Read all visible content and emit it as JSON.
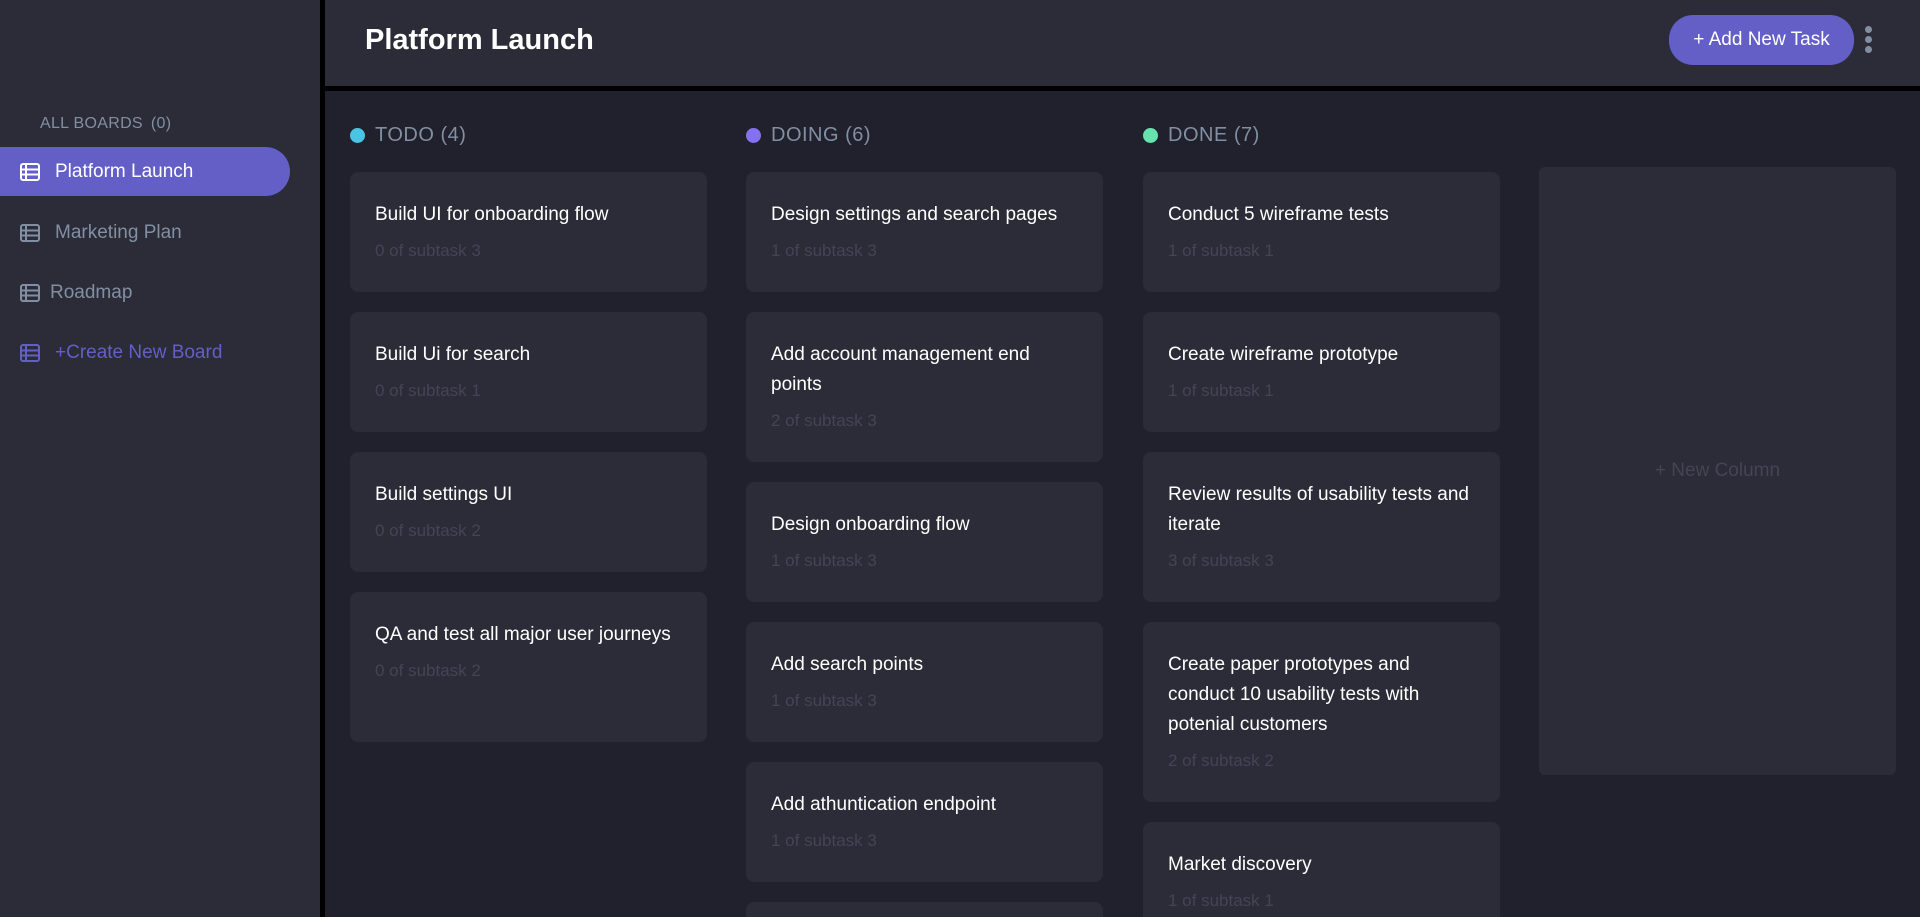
{
  "sidebar": {
    "all_boards_label": "ALL BOARDS",
    "all_boards_count": "(0)",
    "boards": [
      {
        "label": "Platform Launch",
        "active": true
      },
      {
        "label": "Marketing Plan",
        "active": false
      },
      {
        "label": "Roadmap",
        "active": false
      }
    ],
    "create_label": "+Create New Board",
    "board_icon": "board-icon"
  },
  "header": {
    "title": "Platform Launch",
    "add_task_label": "+ Add New Task",
    "menu_icon": "kebab-menu-icon"
  },
  "columns": [
    {
      "label": "TODO (4)",
      "dot_color": "#49c4e5",
      "tasks": [
        {
          "title": "Build UI for onboarding flow",
          "subtasks": "0 of subtask 3"
        },
        {
          "title": "Build Ui for search",
          "subtasks": "0 of subtask 1"
        },
        {
          "title": "Build settings UI",
          "subtasks": "0 of subtask 2"
        },
        {
          "title": "QA and test all major user journeys",
          "subtasks": "0 of subtask 2"
        }
      ]
    },
    {
      "label": "DOING (6)",
      "dot_color": "#8471f2",
      "tasks": [
        {
          "title": "Design settings and search pages",
          "subtasks": "1 of subtask 3"
        },
        {
          "title": "Add account management end points",
          "subtasks": "2 of subtask 3"
        },
        {
          "title": "Design onboarding flow",
          "subtasks": "1 of subtask 3"
        },
        {
          "title": "Add search points",
          "subtasks": "1 of subtask 3"
        },
        {
          "title": "Add athuntication endpoint",
          "subtasks": "1 of subtask 3"
        }
      ]
    },
    {
      "label": "DONE (7)",
      "dot_color": "#67e2ae",
      "tasks": [
        {
          "title": "Conduct 5 wireframe tests",
          "subtasks": "1 of subtask 1"
        },
        {
          "title": "Create wireframe prototype",
          "subtasks": "1 of subtask 1"
        },
        {
          "title": "Review results of usability tests and iterate",
          "subtasks": "3 of subtask 3"
        },
        {
          "title": "Create paper prototypes and conduct 10 usability tests with potenial customers",
          "subtasks": "2 of subtask 2"
        },
        {
          "title": "Market discovery",
          "subtasks": "1 of subtask 1"
        }
      ]
    }
  ],
  "new_column_label": "+ New Column",
  "colors": {
    "accent": "#635fc7",
    "background": "#20212c",
    "surface": "#2b2c37",
    "muted_text": "#828fa3"
  }
}
